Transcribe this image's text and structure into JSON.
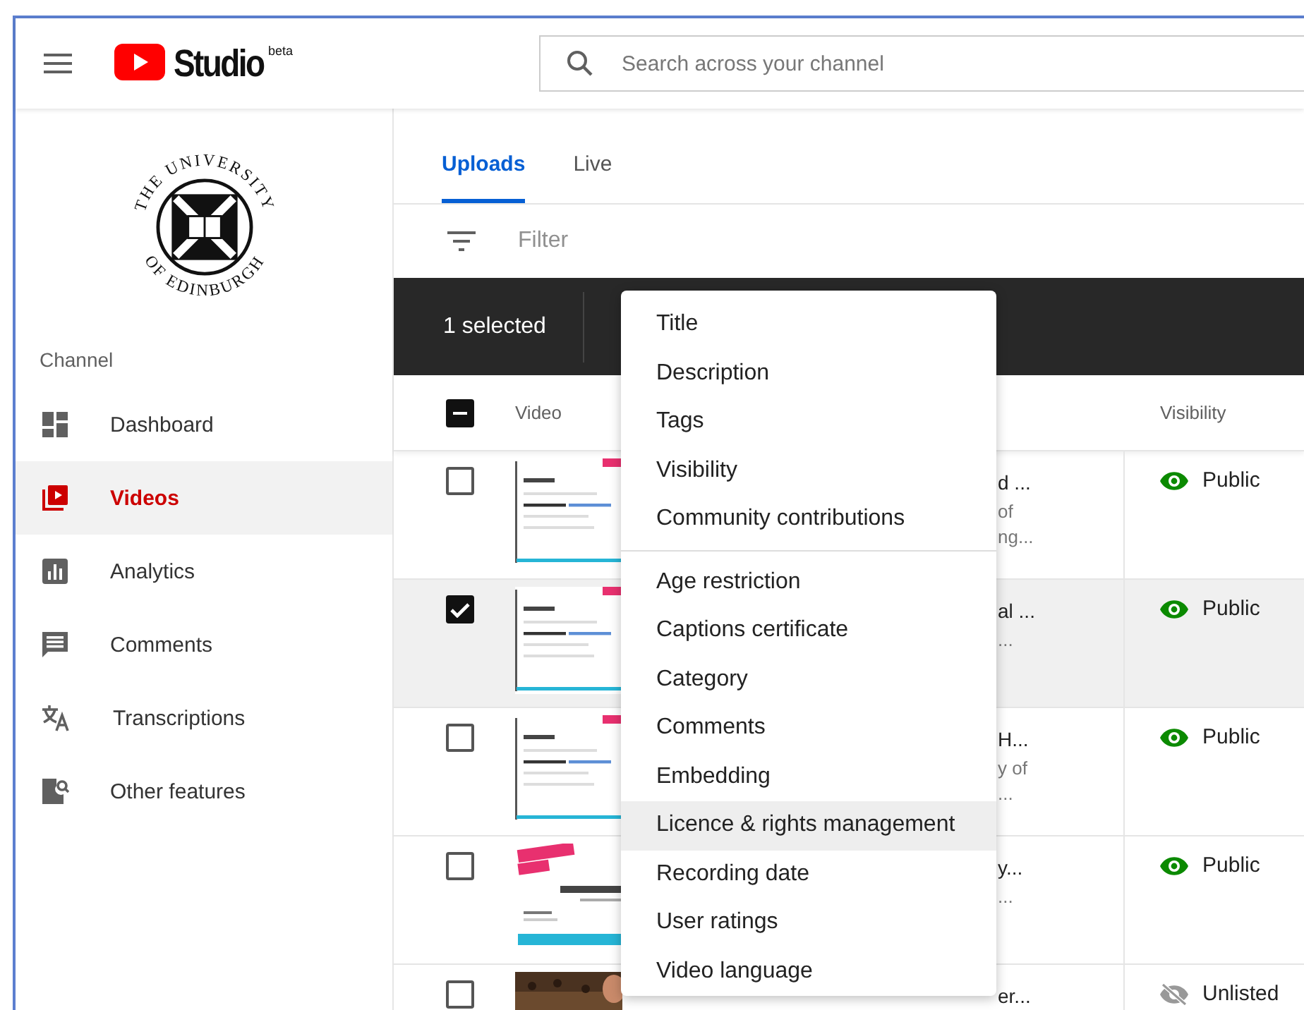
{
  "header": {
    "brand": "Studio",
    "badge": "beta",
    "search": {
      "placeholder": "Search across your channel"
    }
  },
  "sidebar": {
    "logo": {
      "top_text": "THE UNIVERSITY",
      "bottom_text": "OF EDINBURGH"
    },
    "section_label": "Channel",
    "items": [
      {
        "label": "Dashboard",
        "selected": false
      },
      {
        "label": "Videos",
        "selected": true
      },
      {
        "label": "Analytics",
        "selected": false
      },
      {
        "label": "Comments",
        "selected": false
      },
      {
        "label": "Transcriptions",
        "selected": false
      },
      {
        "label": "Other features",
        "selected": false
      }
    ]
  },
  "tabs": [
    {
      "label": "Uploads",
      "selected": true
    },
    {
      "label": "Live",
      "selected": false
    }
  ],
  "filter": {
    "placeholder": "Filter"
  },
  "selection_bar": {
    "text": "1 selected"
  },
  "table": {
    "select_all_partial": true,
    "columns": [
      "Video",
      "Visibility"
    ],
    "rows": [
      {
        "checked": false,
        "title": "d ...",
        "lines": [
          "of",
          "ng..."
        ],
        "visibility": {
          "kind": "public",
          "label": "Public"
        }
      },
      {
        "checked": true,
        "title": "al ...",
        "lines": [
          "..."
        ],
        "visibility": {
          "kind": "public",
          "label": "Public"
        }
      },
      {
        "checked": false,
        "title": "H...",
        "lines": [
          "y of",
          "..."
        ],
        "visibility": {
          "kind": "public",
          "label": "Public"
        }
      },
      {
        "checked": false,
        "title": "y...",
        "lines": [
          "..."
        ],
        "visibility": {
          "kind": "public",
          "label": "Public"
        }
      },
      {
        "checked": false,
        "title": "er...",
        "lines": [],
        "visibility": {
          "kind": "unlisted",
          "label": "Unlisted"
        }
      }
    ]
  },
  "menu": {
    "groups": [
      [
        {
          "label": "Title",
          "highlighted": false
        },
        {
          "label": "Description",
          "highlighted": false
        },
        {
          "label": "Tags",
          "highlighted": false
        },
        {
          "label": "Visibility",
          "highlighted": false
        },
        {
          "label": "Community contributions",
          "highlighted": false
        }
      ],
      [
        {
          "label": "Age restriction",
          "highlighted": false
        },
        {
          "label": "Captions certificate",
          "highlighted": false
        },
        {
          "label": "Category",
          "highlighted": false
        },
        {
          "label": "Comments",
          "highlighted": false
        },
        {
          "label": "Embedding",
          "highlighted": false
        },
        {
          "label": "Licence & rights management",
          "highlighted": true
        },
        {
          "label": "Recording date",
          "highlighted": false
        },
        {
          "label": "User ratings",
          "highlighted": false
        },
        {
          "label": "Video language",
          "highlighted": false
        }
      ]
    ]
  }
}
